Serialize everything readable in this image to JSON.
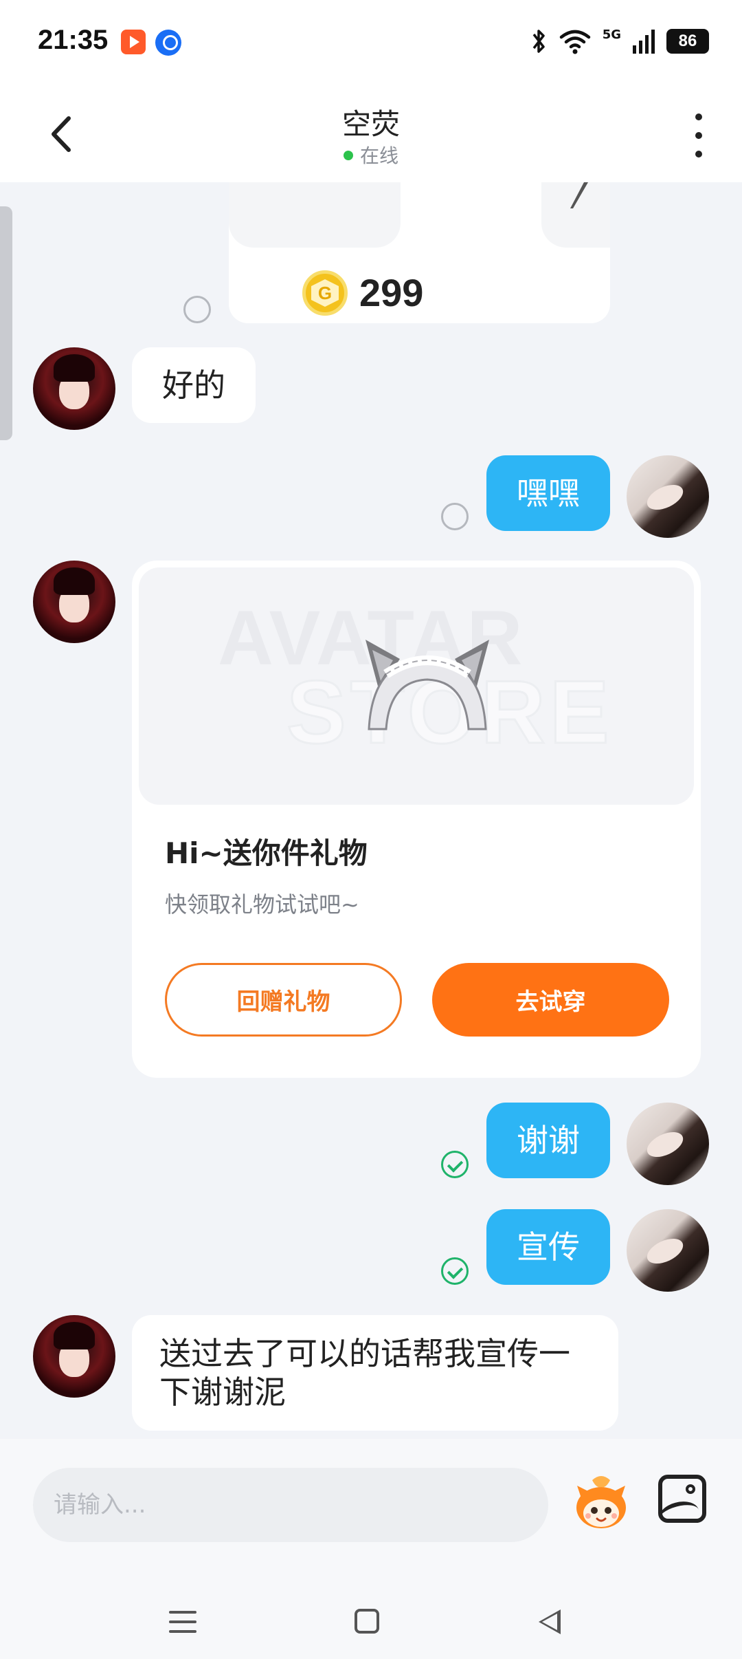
{
  "status_bar": {
    "time": "21:35",
    "network": "5G",
    "battery": "86",
    "icons": [
      "video-app-icon",
      "location-app-icon",
      "bluetooth-icon",
      "wifi-icon",
      "signal-icon",
      "battery-icon"
    ]
  },
  "header": {
    "title": "空荧",
    "status": "在线",
    "status_color": "#2cc24c"
  },
  "messages": [
    {
      "from": "self",
      "type": "gift-price",
      "price": "299",
      "read": false
    },
    {
      "from": "peer",
      "type": "text",
      "text": "好的"
    },
    {
      "from": "self",
      "type": "text",
      "text": "嘿嘿",
      "read": false
    },
    {
      "from": "peer",
      "type": "gift-card",
      "watermark_1": "AVATAR",
      "watermark_2": "STORE",
      "title": "Hi~送你件礼物",
      "subtitle": "快领取礼物试试吧~",
      "button_return": "回赠礼物",
      "button_try": "去试穿"
    },
    {
      "from": "self",
      "type": "text",
      "text": "谢谢",
      "read": true
    },
    {
      "from": "self",
      "type": "text",
      "text": "宣传",
      "read": true
    },
    {
      "from": "peer",
      "type": "text",
      "text": "送过去了可以的话帮我宣传一下谢谢泥"
    }
  ],
  "input": {
    "placeholder": "请输入..."
  },
  "colors": {
    "self_bubble": "#2db5f5",
    "accent_orange": "#ff7214",
    "read_check": "#1fb36a"
  }
}
